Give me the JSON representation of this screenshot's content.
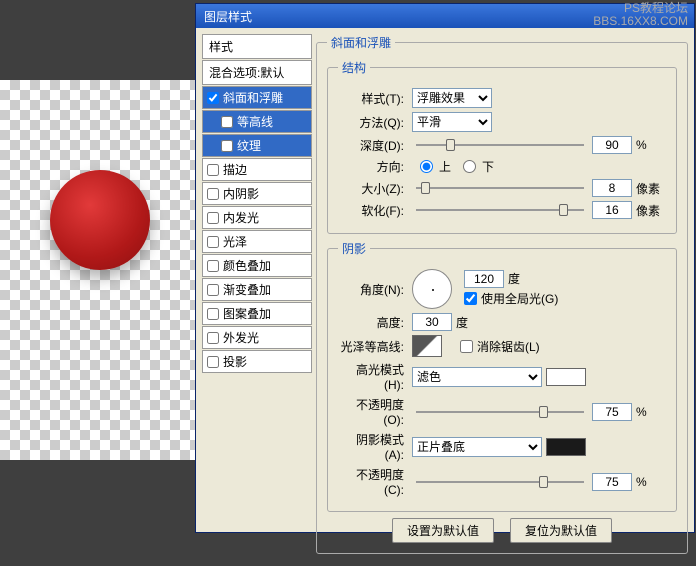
{
  "watermark": {
    "line1": "PS教程论坛",
    "line2": "BBS.16XX8.COM"
  },
  "dialog": {
    "title": "图层样式"
  },
  "leftPanel": {
    "stylesHeader": "样式",
    "blendDefault": "混合选项:默认",
    "items": [
      {
        "label": "斜面和浮雕",
        "checked": true,
        "selected": true
      },
      {
        "label": "等高线",
        "checked": false,
        "sub": true,
        "selected": true
      },
      {
        "label": "纹理",
        "checked": false,
        "sub": true,
        "selected": true
      },
      {
        "label": "描边",
        "checked": false
      },
      {
        "label": "内阴影",
        "checked": false
      },
      {
        "label": "内发光",
        "checked": false
      },
      {
        "label": "光泽",
        "checked": false
      },
      {
        "label": "颜色叠加",
        "checked": false
      },
      {
        "label": "渐变叠加",
        "checked": false
      },
      {
        "label": "图案叠加",
        "checked": false
      },
      {
        "label": "外发光",
        "checked": false
      },
      {
        "label": "投影",
        "checked": false
      }
    ]
  },
  "bevel": {
    "sectionTitle": "斜面和浮雕",
    "structure": {
      "legend": "结构",
      "styleLabel": "样式(T):",
      "styleValue": "浮雕效果",
      "methodLabel": "方法(Q):",
      "methodValue": "平滑",
      "depthLabel": "深度(D):",
      "depthValue": "90",
      "depthUnit": "%",
      "dirLabel": "方向:",
      "up": "上",
      "down": "下",
      "sizeLabel": "大小(Z):",
      "sizeValue": "8",
      "sizeUnit": "像素",
      "softLabel": "软化(F):",
      "softValue": "16",
      "softUnit": "像素"
    },
    "shading": {
      "legend": "阴影",
      "angleLabel": "角度(N):",
      "angleValue": "120",
      "angleUnit": "度",
      "globalLabel": "使用全局光(G)",
      "altLabel": "高度:",
      "altValue": "30",
      "altUnit": "度",
      "glossLabel": "光泽等高线:",
      "antiAliasLabel": "消除锯齿(L)",
      "hiModeLabel": "高光模式(H):",
      "hiModeValue": "滤色",
      "hiOpLabel": "不透明度(O):",
      "hiOpValue": "75",
      "opUnit": "%",
      "shModeLabel": "阴影模式(A):",
      "shModeValue": "正片叠底",
      "shOpLabel": "不透明度(C):",
      "shOpValue": "75"
    },
    "buttons": {
      "setDefault": "设置为默认值",
      "resetDefault": "复位为默认值"
    }
  },
  "colors": {
    "highlight": "#ffffff",
    "shadow": "#1a1a1a"
  }
}
